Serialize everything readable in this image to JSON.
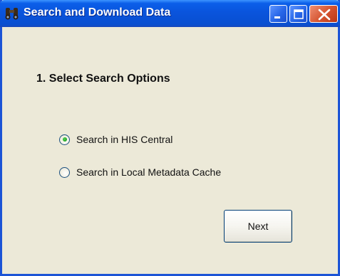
{
  "window": {
    "title": "Search and Download Data",
    "icon": "binoculars-icon"
  },
  "controls": {
    "minimize_icon": "minimize-icon",
    "maximize_icon": "maximize-icon",
    "close_icon": "close-icon"
  },
  "step": {
    "heading": "1. Select Search Options"
  },
  "options": [
    {
      "label": "Search in HIS Central",
      "selected": true
    },
    {
      "label": "Search in Local Metadata Cache",
      "selected": false
    }
  ],
  "buttons": {
    "next_label": "Next"
  },
  "colors": {
    "titlebar": "#0a54dc",
    "window_bg": "#ece9d8",
    "close_button": "#d5532f",
    "radio_selected": "#21a121"
  }
}
